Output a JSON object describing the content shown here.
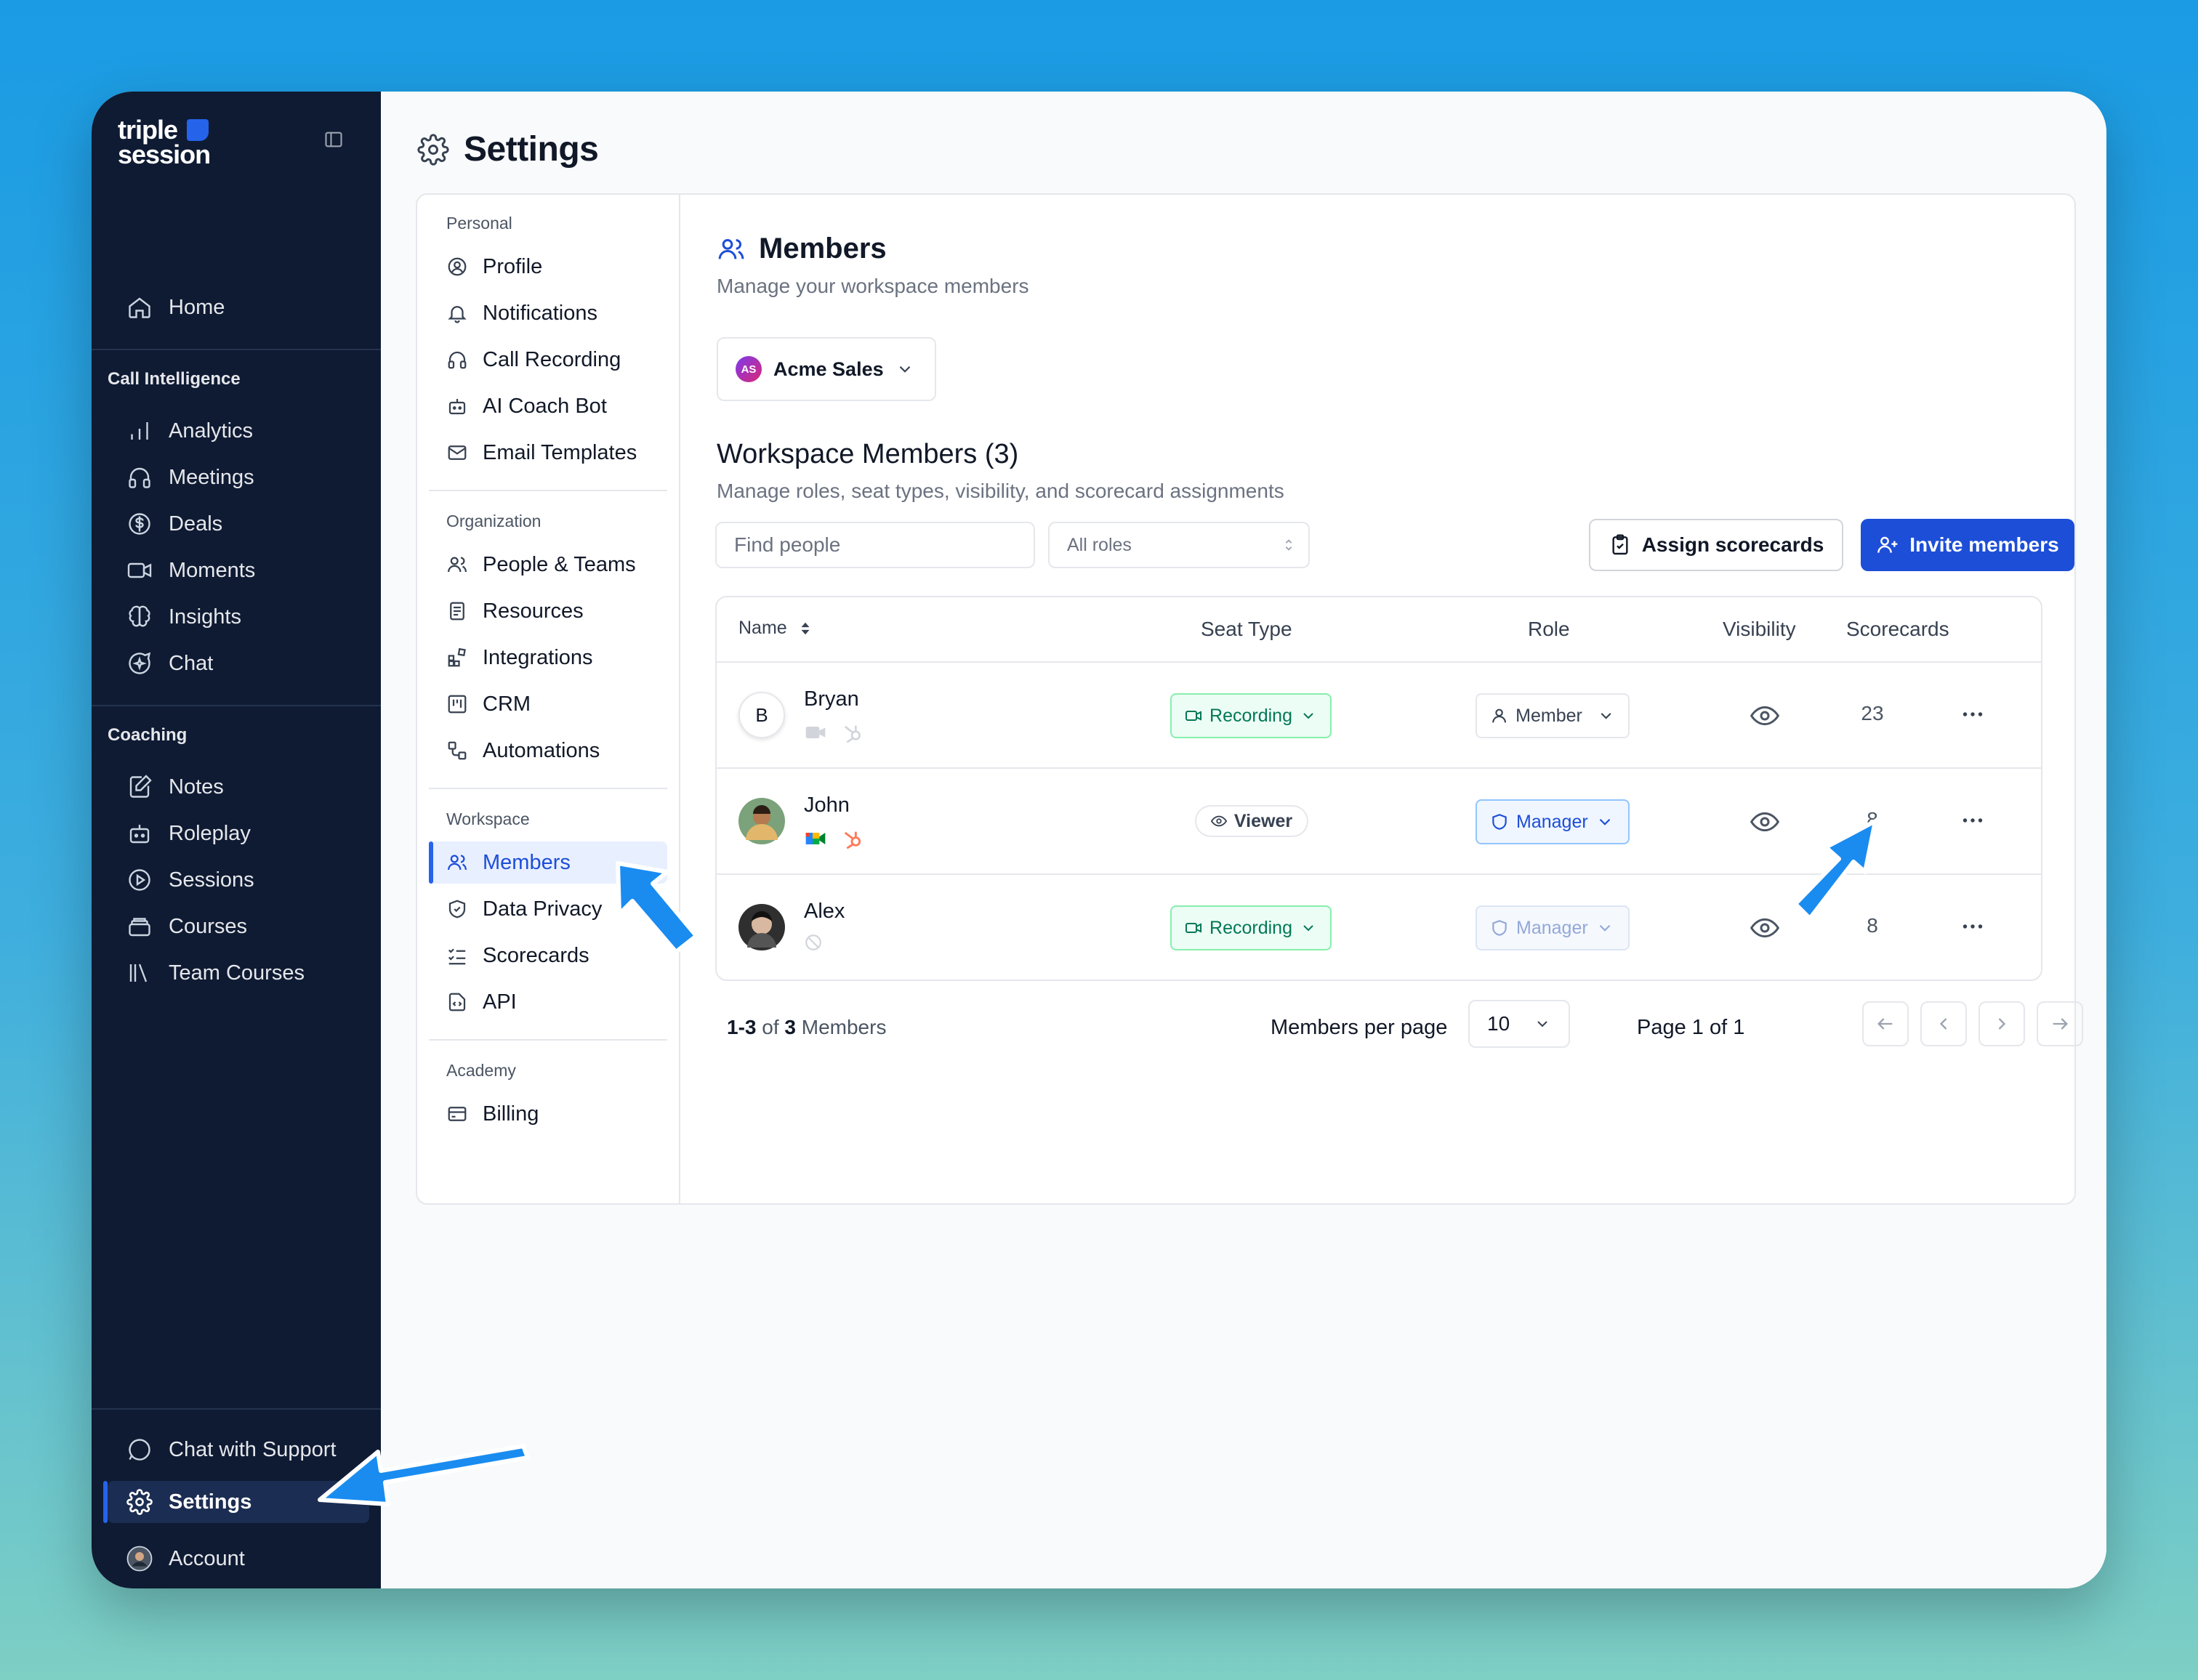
{
  "app": {
    "logo_line1": "triple",
    "logo_line2": "session"
  },
  "sidebar": {
    "home": "Home",
    "section_call_intelligence": "Call Intelligence",
    "call_items": [
      "Analytics",
      "Meetings",
      "Deals",
      "Moments",
      "Insights",
      "Chat"
    ],
    "section_coaching": "Coaching",
    "coaching_items": [
      "Notes",
      "Roleplay",
      "Sessions",
      "Courses",
      "Team Courses"
    ],
    "support": "Chat with Support",
    "settings": "Settings",
    "account": "Account"
  },
  "page": {
    "title": "Settings"
  },
  "settings_nav": {
    "personal": "Personal",
    "personal_items": [
      "Profile",
      "Notifications",
      "Call Recording",
      "AI Coach Bot",
      "Email Templates"
    ],
    "organization": "Organization",
    "organization_items": [
      "People & Teams",
      "Resources",
      "Integrations",
      "CRM",
      "Automations"
    ],
    "workspace": "Workspace",
    "workspace_items": [
      "Members",
      "Data Privacy",
      "Scorecards",
      "API"
    ],
    "academy": "Academy",
    "academy_items": [
      "Billing"
    ]
  },
  "members": {
    "title": "Members",
    "subtitle": "Manage your workspace members",
    "workspace": {
      "initials": "AS",
      "name": "Acme Sales"
    },
    "list_title": "Workspace Members (3)",
    "list_subtitle": "Manage roles, seat types, visibility, and scorecard assignments",
    "search_placeholder": "Find people",
    "role_filter": "All roles",
    "assign_button": "Assign scorecards",
    "invite_button": "Invite members",
    "columns": {
      "name": "Name",
      "seat_type": "Seat Type",
      "role": "Role",
      "visibility": "Visibility",
      "scorecards": "Scorecards"
    },
    "rows": [
      {
        "initial": "B",
        "name": "Bryan",
        "seat": "Recording",
        "role": "Member",
        "scorecards": "23"
      },
      {
        "name": "John",
        "seat": "Viewer",
        "role": "Manager",
        "scorecards": "8"
      },
      {
        "name": "Alex",
        "seat": "Recording",
        "role": "Manager",
        "scorecards": "8"
      }
    ],
    "footer": {
      "range": "1-3",
      "of": "of",
      "total": "3",
      "label": "Members"
    },
    "per_page_label": "Members per page",
    "per_page_value": "10",
    "page_info": "Page 1 of 1"
  },
  "colors": {
    "sidebar_bg": "#0f1b33",
    "accent": "#1d4ed8",
    "annotation_arrow": "#1a8cf0"
  }
}
